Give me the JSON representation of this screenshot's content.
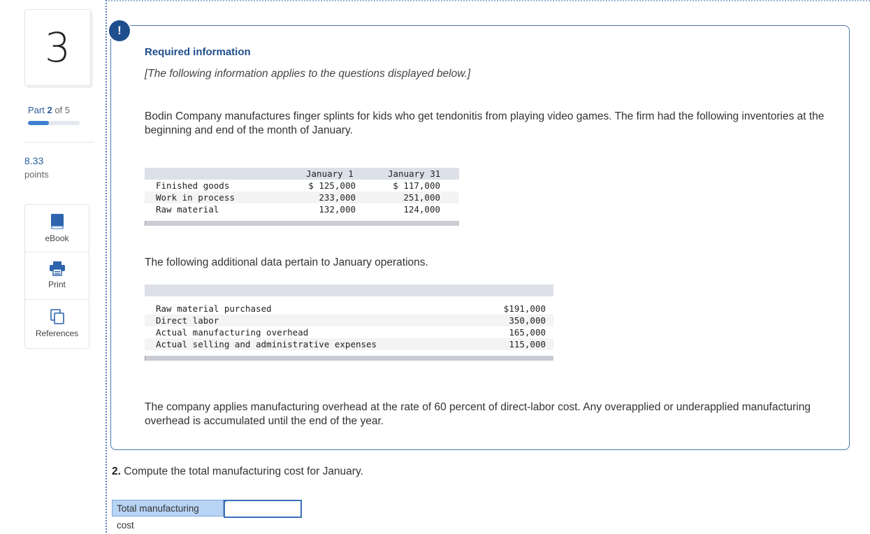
{
  "sidebar": {
    "question_number": "3",
    "part_prefix": "Part",
    "part_current": "2",
    "part_of": "of 5",
    "progress_fraction": 0.4,
    "points_value": "8.33",
    "points_label": "points",
    "tools": [
      {
        "label": "eBook",
        "icon": "book-icon"
      },
      {
        "label": "Print",
        "icon": "printer-icon"
      },
      {
        "label": "References",
        "icon": "documents-icon"
      }
    ]
  },
  "info": {
    "badge": "!",
    "title": "Required information",
    "subtitle": "[The following information applies to the questions displayed below.]",
    "intro": "Bodin Company manufactures finger splints for kids who get tendonitis from playing video games. The firm had the following inventories at the beginning and end of the month of January.",
    "inventory_table": {
      "headers": [
        "",
        "January 1",
        "January 31"
      ],
      "rows": [
        [
          "Finished goods",
          "$ 125,000",
          "$ 117,000"
        ],
        [
          "Work in process",
          "233,000",
          "251,000"
        ],
        [
          "Raw material",
          "132,000",
          "124,000"
        ]
      ]
    },
    "additional_text": "The following additional data pertain to January operations.",
    "operations_table": {
      "rows": [
        [
          "Raw material purchased",
          "$191,000"
        ],
        [
          "Direct labor",
          "350,000"
        ],
        [
          "Actual manufacturing overhead",
          "165,000"
        ],
        [
          "Actual selling and administrative expenses",
          "115,000"
        ]
      ]
    },
    "closing": "The company applies manufacturing overhead at the rate of 60 percent of direct-labor cost. Any overapplied or underapplied manufacturing overhead is accumulated until the end of the year."
  },
  "question": {
    "number": "2.",
    "text": "Compute the total manufacturing cost for January.",
    "answer_label": "Total manufacturing cost",
    "answer_value": ""
  },
  "colors": {
    "accent": "#1f4e8c",
    "panel_border": "#4a76b4",
    "progress_fill": "#3f7fd0",
    "answer_label_bg": "#b8d4f5"
  }
}
